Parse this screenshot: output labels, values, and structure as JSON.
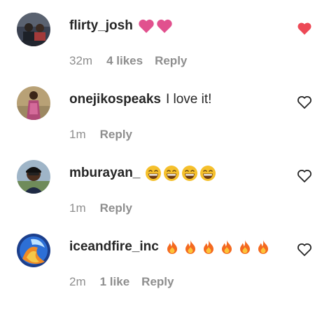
{
  "colors": {
    "text_primary": "#262626",
    "text_secondary": "#8e8e8e",
    "like_red": "#ed4956",
    "pink_heart": "#e1518e",
    "grin_yellow": "#f5c02c",
    "fire_orange": "#f4691f"
  },
  "comments": [
    {
      "username": "flirty_josh",
      "text": "",
      "emojis": [
        "pink-heart-icon",
        "pink-heart-icon"
      ],
      "time": "32m",
      "likes": "4 likes",
      "reply": "Reply",
      "liked": true
    },
    {
      "username": "onejikospeaks",
      "text": "I love it!",
      "emojis": [],
      "time": "1m",
      "likes": "",
      "reply": "Reply",
      "liked": false
    },
    {
      "username": "mburayan_",
      "text": "",
      "emojis": [
        "grinning-face-icon",
        "grinning-face-icon",
        "grinning-face-icon",
        "grinning-face-icon"
      ],
      "time": "1m",
      "likes": "",
      "reply": "Reply",
      "liked": false
    },
    {
      "username": "iceandfire_inc",
      "text": "",
      "emojis": [
        "fire-icon",
        "fire-icon",
        "fire-icon",
        "fire-icon",
        "fire-icon",
        "fire-icon"
      ],
      "time": "2m",
      "likes": "1 like",
      "reply": "Reply",
      "liked": false
    }
  ]
}
